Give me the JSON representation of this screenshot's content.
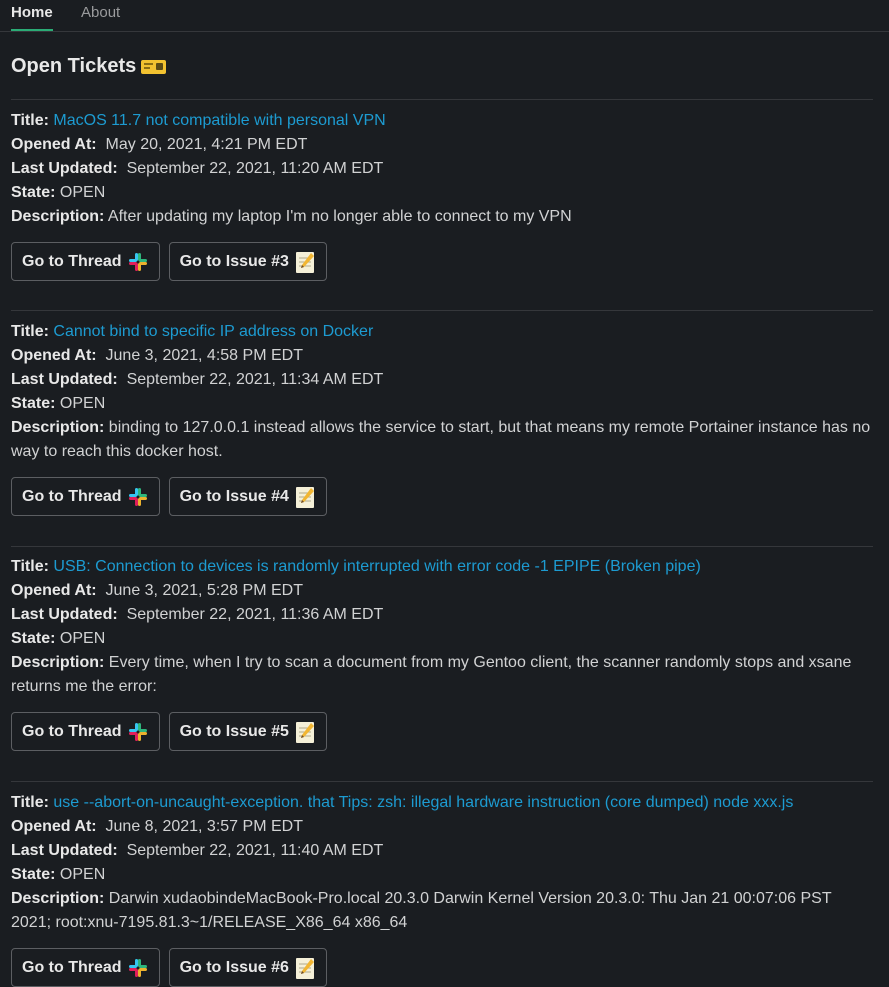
{
  "tabs": [
    {
      "label": "Home",
      "active": true
    },
    {
      "label": "About",
      "active": false
    }
  ],
  "heading": {
    "title": "Open Tickets"
  },
  "labels": {
    "title": "Title:",
    "opened_at": "Opened At:",
    "last_updated": "Last Updated:",
    "state": "State:",
    "description": "Description:"
  },
  "tickets": [
    {
      "title": "MacOS 11.7 not compatible with personal VPN",
      "opened_at": "May 20, 2021, 4:21 PM EDT",
      "last_updated": "September 22, 2021, 11:20 AM EDT",
      "state": "OPEN",
      "description": "After updating my laptop I'm no longer able to connect to my VPN",
      "thread_button": "Go to Thread",
      "issue_button": "Go to Issue #3"
    },
    {
      "title": "Cannot bind to specific IP address on Docker",
      "opened_at": "June 3, 2021, 4:58 PM EDT",
      "last_updated": "September 22, 2021, 11:34 AM EDT",
      "state": "OPEN",
      "description": "binding to 127.0.0.1 instead allows the service to start, but that means my remote Portainer instance has no way to reach this docker host.",
      "thread_button": "Go to Thread",
      "issue_button": "Go to Issue #4"
    },
    {
      "title": "USB: Connection to devices is randomly interrupted with error code -1 EPIPE (Broken pipe)",
      "opened_at": "June 3, 2021, 5:28 PM EDT",
      "last_updated": "September 22, 2021, 11:36 AM EDT",
      "state": "OPEN",
      "description": "Every time, when I try to scan a document from my Gentoo client, the scanner randomly stops and xsane returns me the error:",
      "thread_button": "Go to Thread",
      "issue_button": "Go to Issue #5"
    },
    {
      "title": "use --abort-on-uncaught-exception. that Tips: zsh: illegal hardware instruction (core dumped) node xxx.js",
      "opened_at": "June 8, 2021, 3:57 PM EDT",
      "last_updated": "September 22, 2021, 11:40 AM EDT",
      "state": "OPEN",
      "description": "Darwin xudaobindeMacBook-Pro.local 20.3.0 Darwin Kernel Version 20.3.0: Thu Jan 21 00:07:06 PST 2021; root:xnu-7195.81.3~1/RELEASE_X86_64 x86_64",
      "thread_button": "Go to Thread",
      "issue_button": "Go to Issue #6"
    }
  ],
  "colors": {
    "background": "#1a1d21",
    "link": "#1d9bd1",
    "active_tab_underline": "#2bac76",
    "divider": "#35373b"
  },
  "icons": {
    "heading_icon": "ticket-icon",
    "thread_icon": "slack-icon",
    "issue_icon": "memo-icon"
  }
}
